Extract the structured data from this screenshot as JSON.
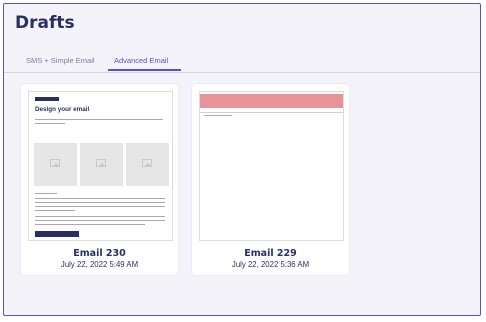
{
  "page": {
    "title": "Drafts"
  },
  "tabs": [
    {
      "label": "SMS + Simple Email",
      "active": false
    },
    {
      "label": "Advanced Email",
      "active": true
    }
  ],
  "drafts": [
    {
      "name": "Email 230",
      "date": "July 22, 2022 5:49 AM",
      "thumbnail": {
        "heading": "Design your email"
      }
    },
    {
      "name": "Email 229",
      "date": "July 22, 2022 5:36 AM"
    }
  ],
  "colors": {
    "accent": "#5b4fd0",
    "navy": "#2a2f63",
    "banner": "#e8939a",
    "background": "#f4f3fa"
  }
}
